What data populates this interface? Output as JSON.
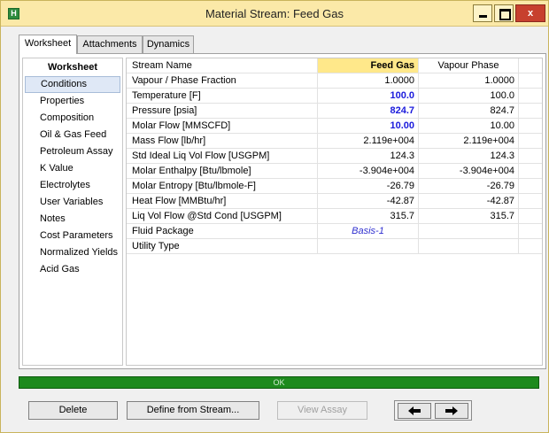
{
  "window": {
    "title": "Material Stream: Feed Gas",
    "app_icon_glyph": "H",
    "close_glyph": "x"
  },
  "tabs": [
    "Worksheet",
    "Attachments",
    "Dynamics"
  ],
  "sidebar": {
    "heading": "Worksheet",
    "items": [
      "Conditions",
      "Properties",
      "Composition",
      "Oil & Gas Feed",
      "Petroleum Assay",
      "K Value",
      "Electrolytes",
      "User Variables",
      "Notes",
      "Cost Parameters",
      "Normalized Yields",
      "Acid Gas"
    ],
    "selected_index": 0
  },
  "grid": {
    "header": {
      "label": "Stream Name",
      "feed": "Feed Gas",
      "vapour": "Vapour Phase"
    },
    "rows": [
      {
        "label": "Vapour / Phase Fraction",
        "feed": "1.0000",
        "vapour": "1.0000",
        "specified": false
      },
      {
        "label": "Temperature [F]",
        "feed": "100.0",
        "vapour": "100.0",
        "specified": true
      },
      {
        "label": "Pressure [psia]",
        "feed": "824.7",
        "vapour": "824.7",
        "specified": true
      },
      {
        "label": "Molar Flow [MMSCFD]",
        "feed": "10.00",
        "vapour": "10.00",
        "specified": true
      },
      {
        "label": "Mass Flow [lb/hr]",
        "feed": "2.119e+004",
        "vapour": "2.119e+004",
        "specified": false
      },
      {
        "label": "Std Ideal Liq Vol Flow [USGPM]",
        "feed": "124.3",
        "vapour": "124.3",
        "specified": false
      },
      {
        "label": "Molar Enthalpy [Btu/lbmole]",
        "feed": "-3.904e+004",
        "vapour": "-3.904e+004",
        "specified": false
      },
      {
        "label": "Molar Entropy [Btu/lbmole-F]",
        "feed": "-26.79",
        "vapour": "-26.79",
        "specified": false
      },
      {
        "label": "Heat Flow [MMBtu/hr]",
        "feed": "-42.87",
        "vapour": "-42.87",
        "specified": false
      },
      {
        "label": "Liq Vol Flow @Std Cond [USGPM]",
        "feed": "315.7",
        "vapour": "315.7",
        "specified": false
      },
      {
        "label": "Fluid Package",
        "feed": "Basis-1",
        "vapour": "",
        "specified": false
      },
      {
        "label": "Utility Type",
        "feed": "",
        "vapour": "",
        "specified": false
      }
    ]
  },
  "status": "OK",
  "buttons": {
    "delete": "Delete",
    "define": "Define from Stream...",
    "view_assay": "View Assay"
  },
  "icons": {
    "prev": "left-arrow-icon",
    "next": "right-arrow-icon"
  },
  "colors": {
    "specified_value": "#1a1adc",
    "status_ok": "#1e8a1e",
    "header_highlight": "#ffe88a",
    "title_bar": "#fbe9a8"
  }
}
